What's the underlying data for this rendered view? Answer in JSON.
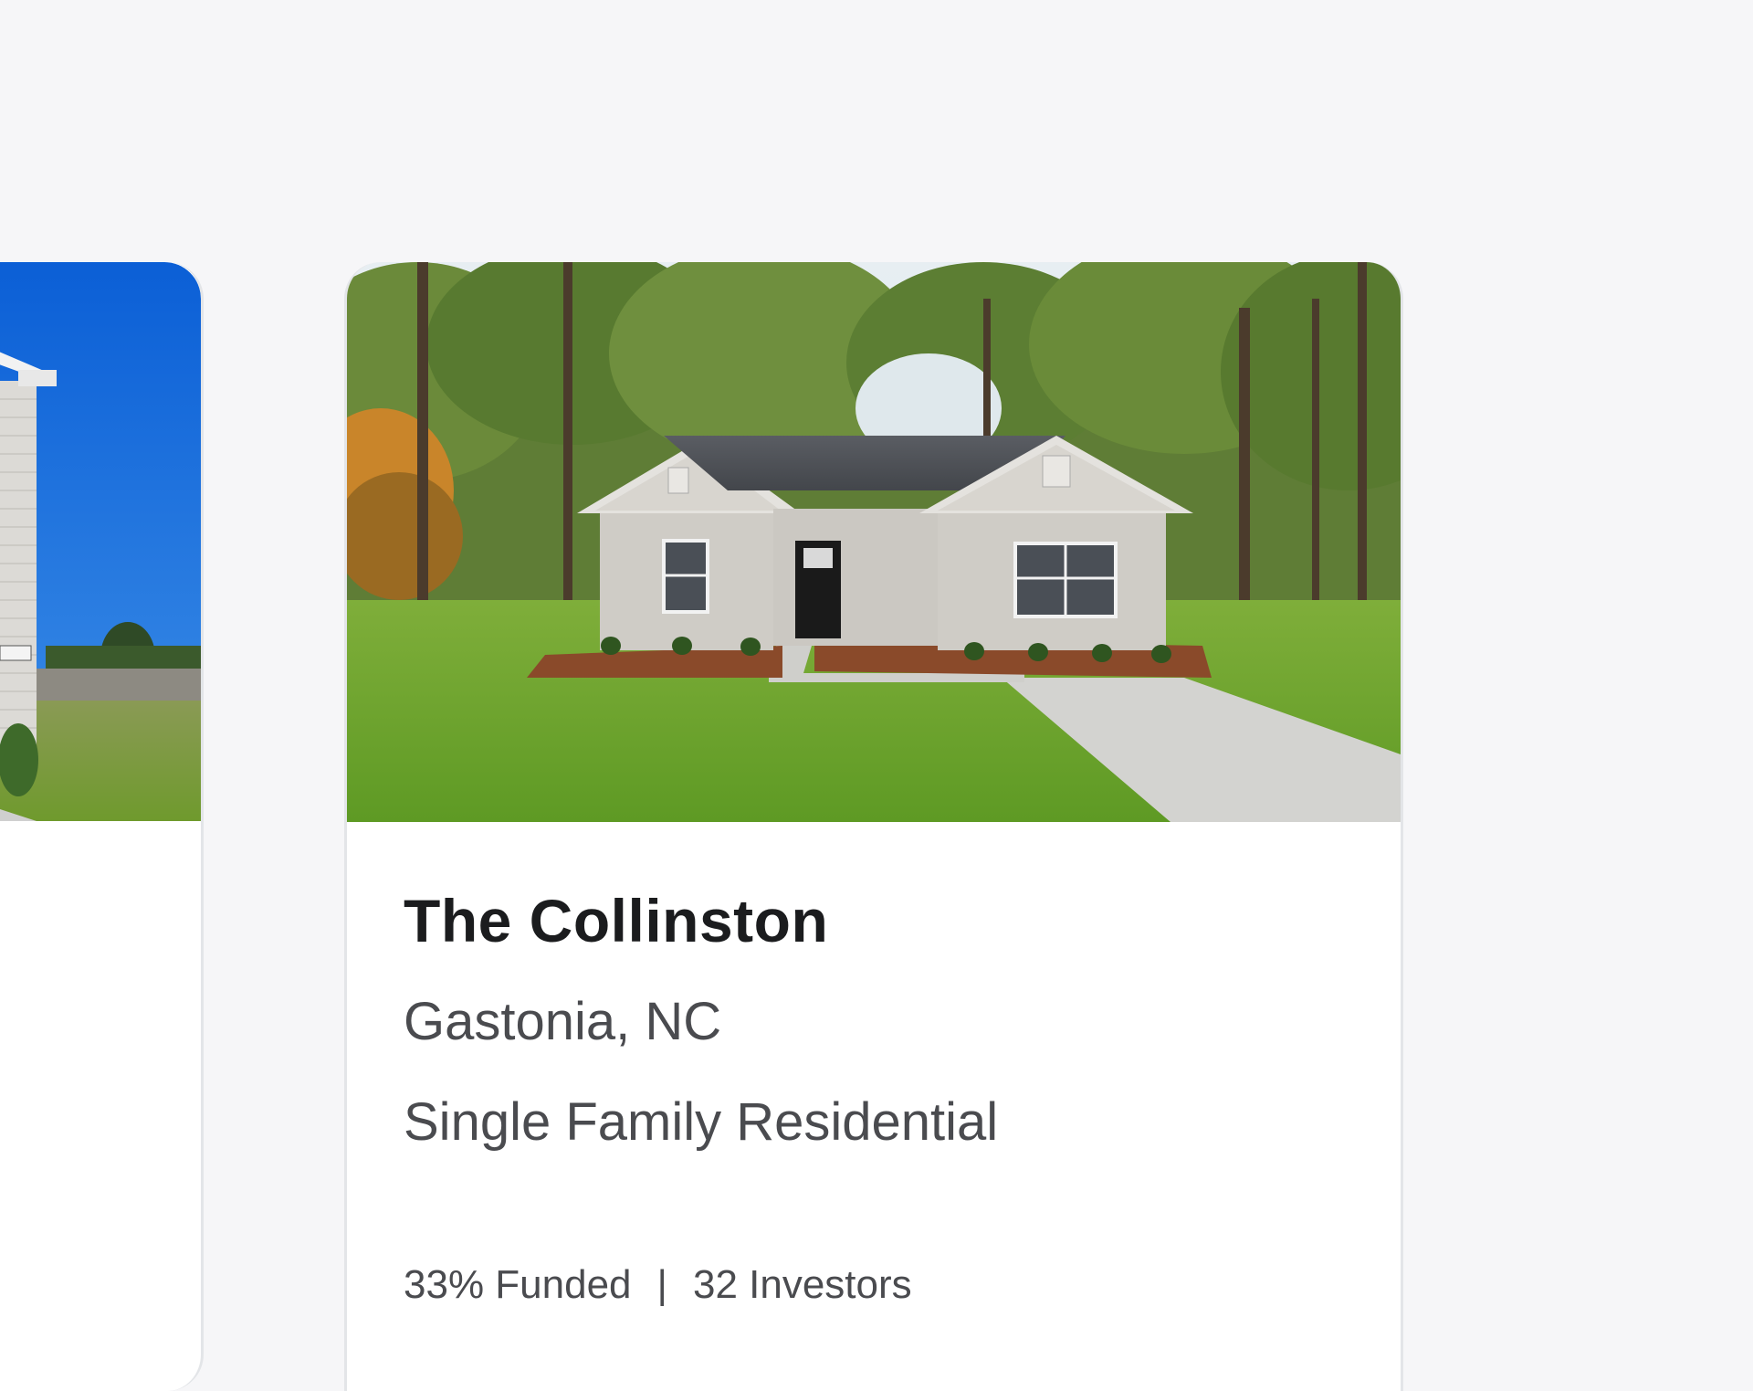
{
  "cards": [
    {
      "image": "house-photo-brick-exterior",
      "visible": "partial"
    },
    {
      "image": "house-photo-single-family-ranch",
      "title": "The Collinston",
      "location": "Gastonia, NC",
      "property_type": "Single Family Residential",
      "stats": {
        "funded": "33% Funded",
        "separator": "|",
        "investors": "32 Investors"
      }
    }
  ],
  "colors": {
    "page_background": "#f6f6f8",
    "card_background": "#ffffff",
    "title_text": "#1b1c1e",
    "body_text": "#4a4b4f",
    "card_border": "#e3e5e8"
  }
}
